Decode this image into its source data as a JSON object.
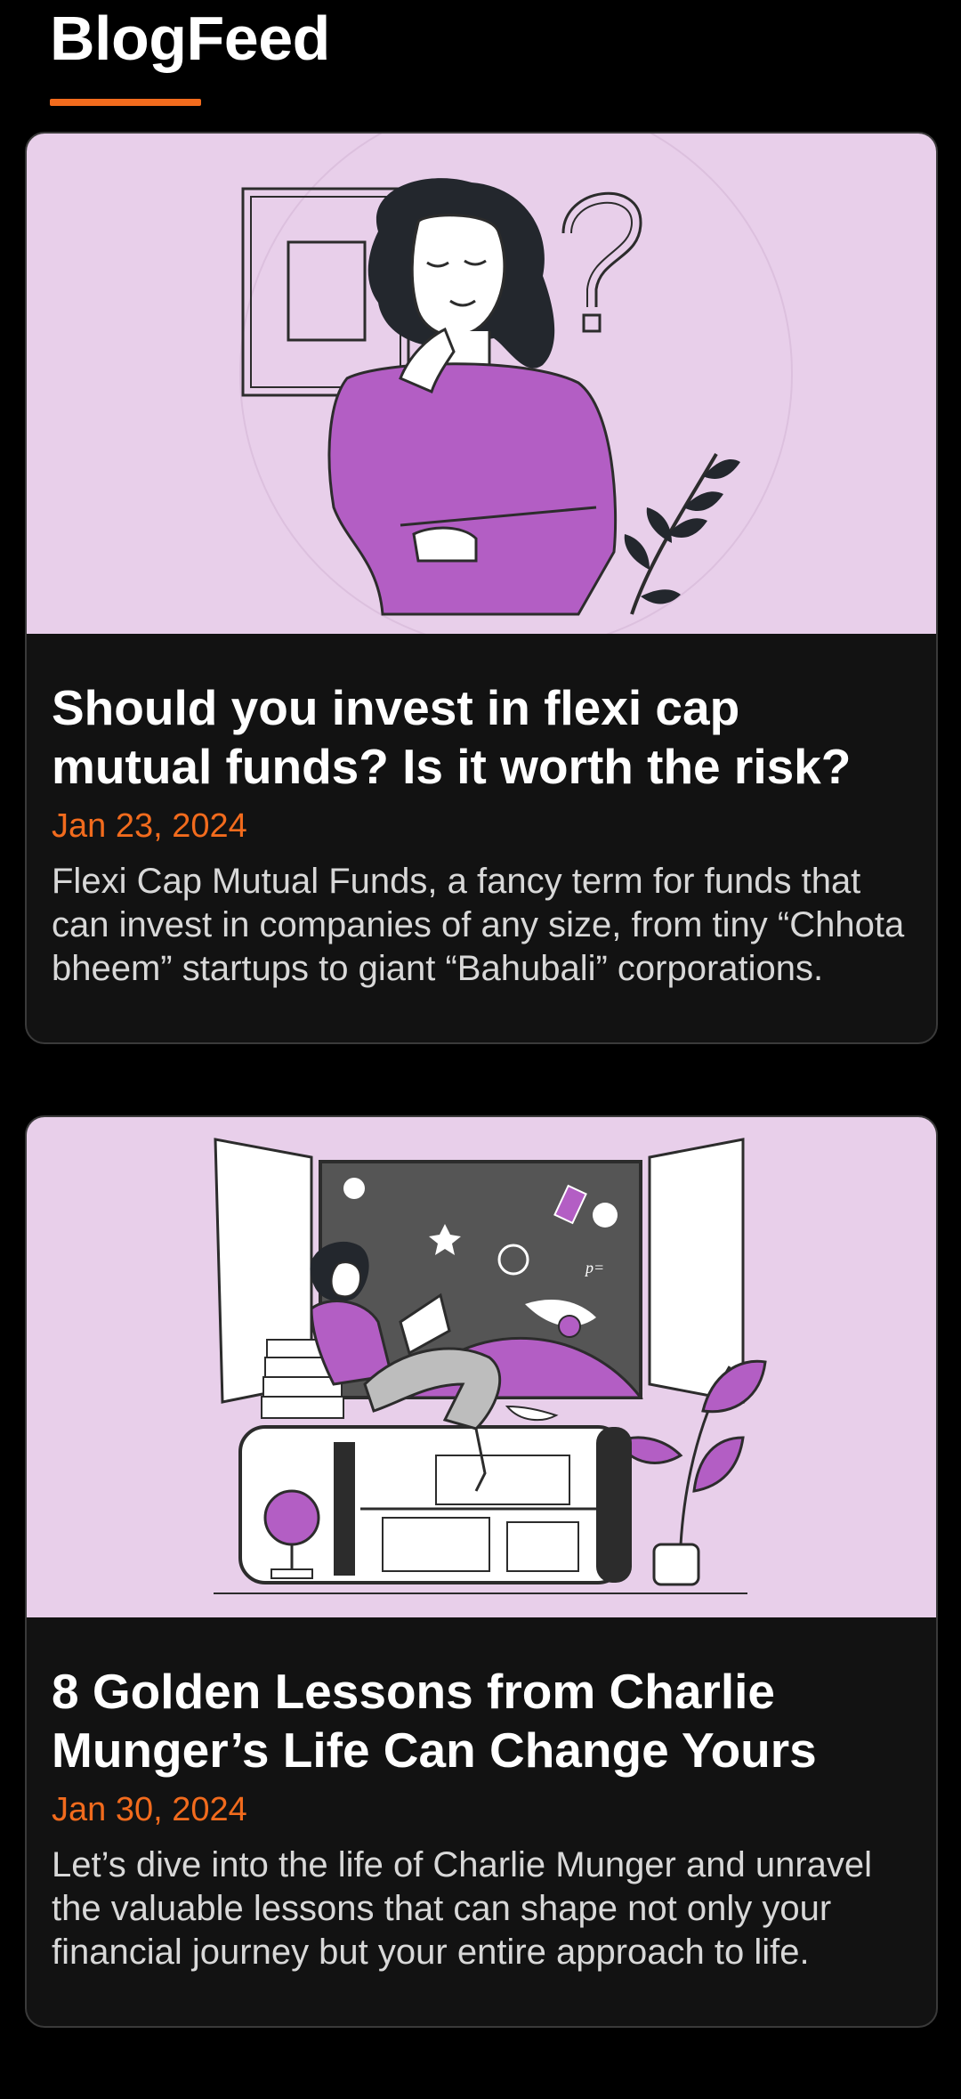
{
  "app": {
    "title": "BlogFeed",
    "accent_color": "#f26b1d",
    "background_color": "#000000",
    "card_image_background": "#e8cfea",
    "illustration_accent": "#b35ec4"
  },
  "posts": [
    {
      "title": "Should you invest in flexi cap mutual funds? Is it worth the risk?",
      "date": "Jan 23, 2024",
      "excerpt": "Flexi Cap Mutual Funds, a fancy term for funds that can invest in companies of any size, from tiny “Chhota bheem” startups to giant “Bahubali” corporations.",
      "image": "thinking-woman-illustration"
    },
    {
      "title": "8 Golden Lessons from Charlie Munger’s Life Can Change Yours",
      "date": "Jan 30, 2024",
      "excerpt": "Let’s dive into the life of Charlie Munger and unravel the valuable lessons that can shape not only your financial journey but your entire approach to life.",
      "image": "reading-woman-illustration"
    }
  ]
}
